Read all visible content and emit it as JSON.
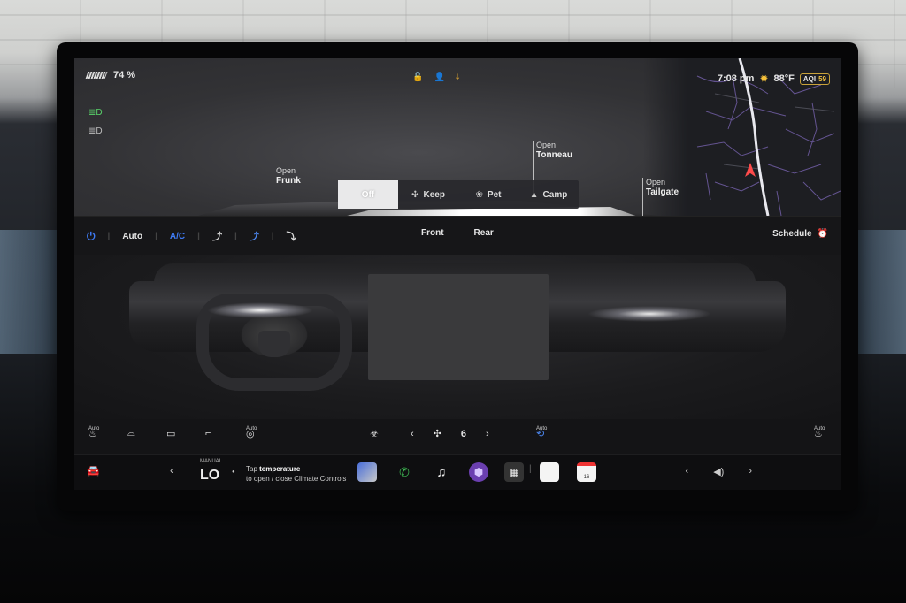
{
  "status": {
    "battery_percent": "74 %",
    "time": "7:08 pm",
    "temperature": "88°F",
    "aqi_label": "AQI",
    "aqi_value": "59"
  },
  "callouts": {
    "frunk": {
      "action": "Open",
      "name": "Frunk"
    },
    "tonneau": {
      "action": "Open",
      "name": "Tonneau"
    },
    "tailgate": {
      "action": "Open",
      "name": "Tailgate"
    }
  },
  "climate_modes": [
    {
      "label": "Off",
      "icon": "off",
      "active": true
    },
    {
      "label": "Keep",
      "icon": "fan-icon",
      "active": false
    },
    {
      "label": "Pet",
      "icon": "paw-icon",
      "active": false
    },
    {
      "label": "Camp",
      "icon": "tent-icon",
      "active": false
    }
  ],
  "climate_bar": {
    "auto_label": "Auto",
    "ac_label": "A/C",
    "front_label": "Front",
    "rear_label": "Rear",
    "schedule_label": "Schedule"
  },
  "seat_row": {
    "auto_label": "Auto",
    "fan_speed": "6"
  },
  "dock": {
    "manual_label": "MANUAL",
    "temp_value": "LO",
    "hint_prefix": "Tap",
    "hint_bold": "temperature",
    "hint_rest": "to open / close Climate Controls",
    "calendar_day": "16"
  },
  "colors": {
    "accent_blue": "#3f7bf5",
    "headlight_green": "#59d36a",
    "sun_yellow": "#f5c03a"
  }
}
